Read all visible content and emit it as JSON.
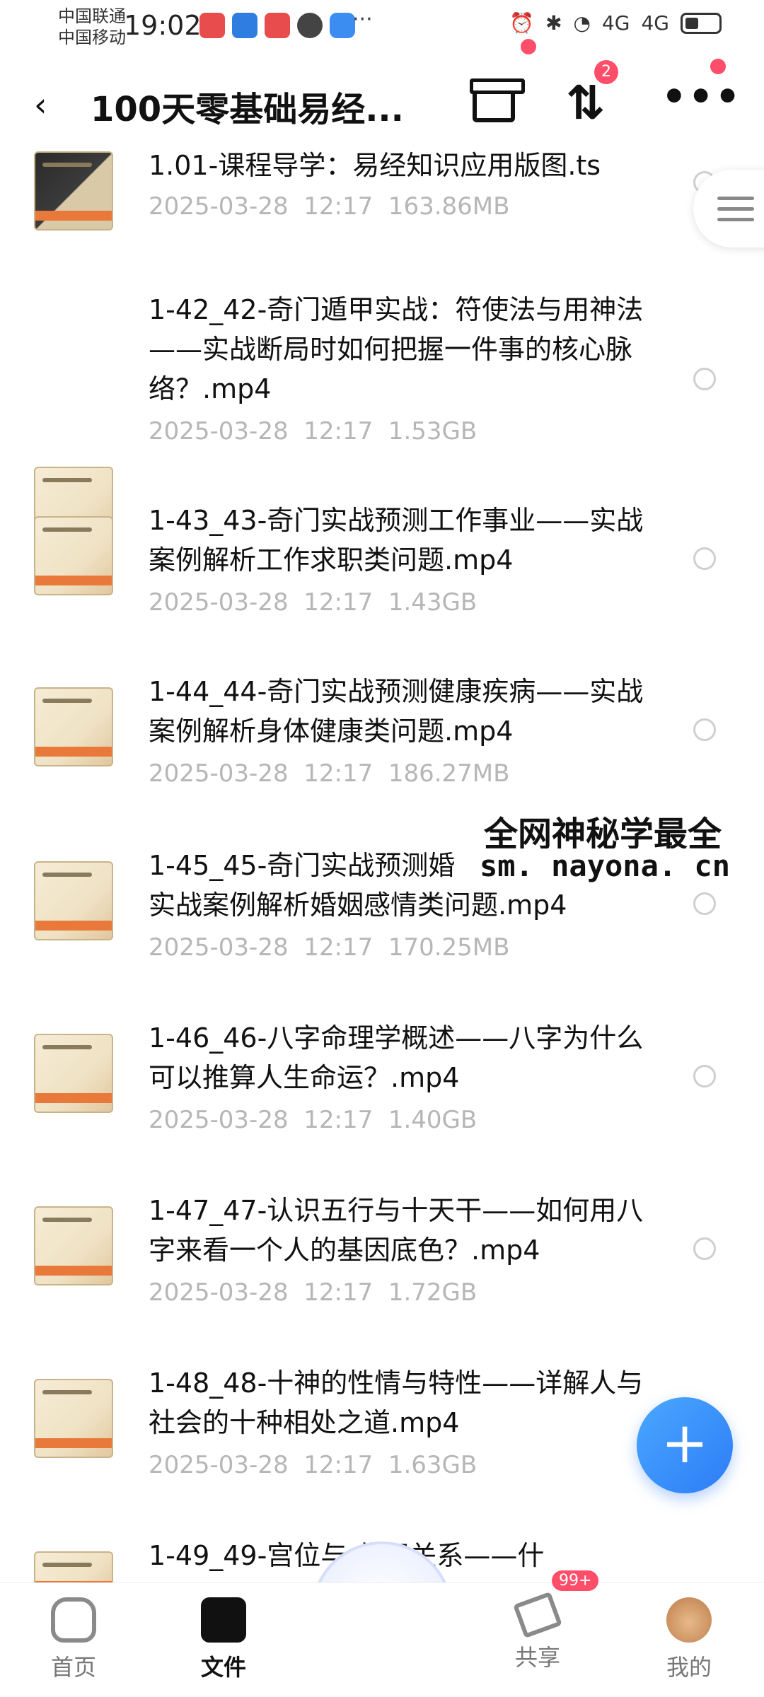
{
  "status_bar": {
    "carrier_1": "中国联通",
    "carrier_2": "中国移动",
    "time": "19:02",
    "more": "···",
    "signal_1": "4G",
    "signal_2": "4G"
  },
  "nav": {
    "title": "100天零基础易经...",
    "sort_badge": "2"
  },
  "files": [
    {
      "name": "1.01-课程导学：易经知识应用版图.ts",
      "date": "2025-03-28",
      "time": "12:17",
      "size": "163.86MB"
    },
    {
      "name": "1-42_42-奇门遁甲实战：符使法与用神法——实战断局时如何把握一件事的核心脉络？.mp4",
      "date": "2025-03-28",
      "time": "12:17",
      "size": "1.53GB"
    },
    {
      "name": "1-43_43-奇门实战预测工作事业——实战案例解析工作求职类问题.mp4",
      "date": "2025-03-28",
      "time": "12:17",
      "size": "1.43GB"
    },
    {
      "name": "1-44_44-奇门实战预测健康疾病——实战案例解析身体健康类问题.mp4",
      "date": "2025-03-28",
      "time": "12:17",
      "size": "186.27MB"
    },
    {
      "name": "1-45_45-奇门实战预测婚",
      "name_line2": "实战案例解析婚姻感情类问题.mp4",
      "date": "2025-03-28",
      "time": "12:17",
      "size": "170.25MB"
    },
    {
      "name": "1-46_46-八字命理学概述——八字为什么可以推算人生命运？.mp4",
      "date": "2025-03-28",
      "time": "12:17",
      "size": "1.40GB"
    },
    {
      "name": "1-47_47-认识五行与十天干——如何用八字来看一个人的基因底色？.mp4",
      "date": "2025-03-28",
      "time": "12:17",
      "size": "1.72GB"
    },
    {
      "name": "1-48_48-十神的性情与特性——详解人与社会的十种相处之道.mp4",
      "date": "2025-03-28",
      "time": "12:17",
      "size": "1.63GB"
    },
    {
      "name": "1-49_49-宫位与   作用关系——什",
      "date": "",
      "time": "",
      "size": ""
    }
  ],
  "watermark": {
    "line1": "全网神秘学最全",
    "line2": "sm. nayona. cn"
  },
  "tabs": [
    {
      "label": "首页"
    },
    {
      "label": "文件"
    },
    {
      "label": "共享"
    },
    {
      "label": "我的"
    }
  ],
  "share_badge": "99+",
  "fab_label": "+"
}
